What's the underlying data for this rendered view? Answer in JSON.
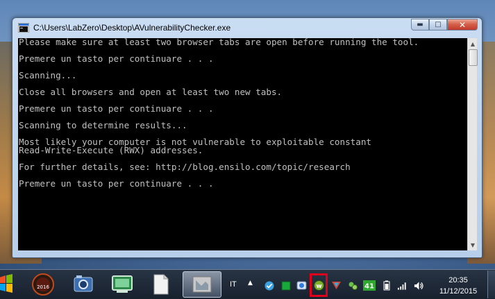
{
  "window": {
    "title": "C:\\Users\\LabZero\\Desktop\\AVulnerabilityChecker.exe",
    "minimize_glyph": "▬",
    "maximize_glyph": "□",
    "close_glyph": "✕"
  },
  "console": {
    "lines": [
      "Please make sure at least two browser tabs are open before running the tool.",
      "",
      "Premere un tasto per continuare . . .",
      "",
      "Scanning...",
      "",
      "Close all browsers and open at least two new tabs.",
      "",
      "Premere un tasto per continuare . . .",
      "",
      "Scanning to determine results...",
      "",
      "Most likely your computer is not vulnerable to exploitable constant",
      "Read-Write-Execute (RWX) addresses.",
      "",
      "For further details, see: http://blog.ensilo.com/topic/research",
      "",
      "Premere un tasto per continuare . . ."
    ]
  },
  "taskbar": {
    "pinned": [
      {
        "name": "start-orb-icon"
      },
      {
        "name": "badge-2016-app-icon",
        "label": "2016"
      },
      {
        "name": "screenshot-camera-icon"
      },
      {
        "name": "remote-desktop-icon"
      },
      {
        "name": "document-icon"
      },
      {
        "name": "console-app-icon"
      }
    ],
    "language": "IT",
    "tray_badge": "41",
    "clock": {
      "time": "20:35",
      "date": "11/12/2015"
    }
  },
  "colors": {
    "console_bg": "#000000",
    "console_fg": "#c0c0c0",
    "highlight": "#e0001a"
  }
}
